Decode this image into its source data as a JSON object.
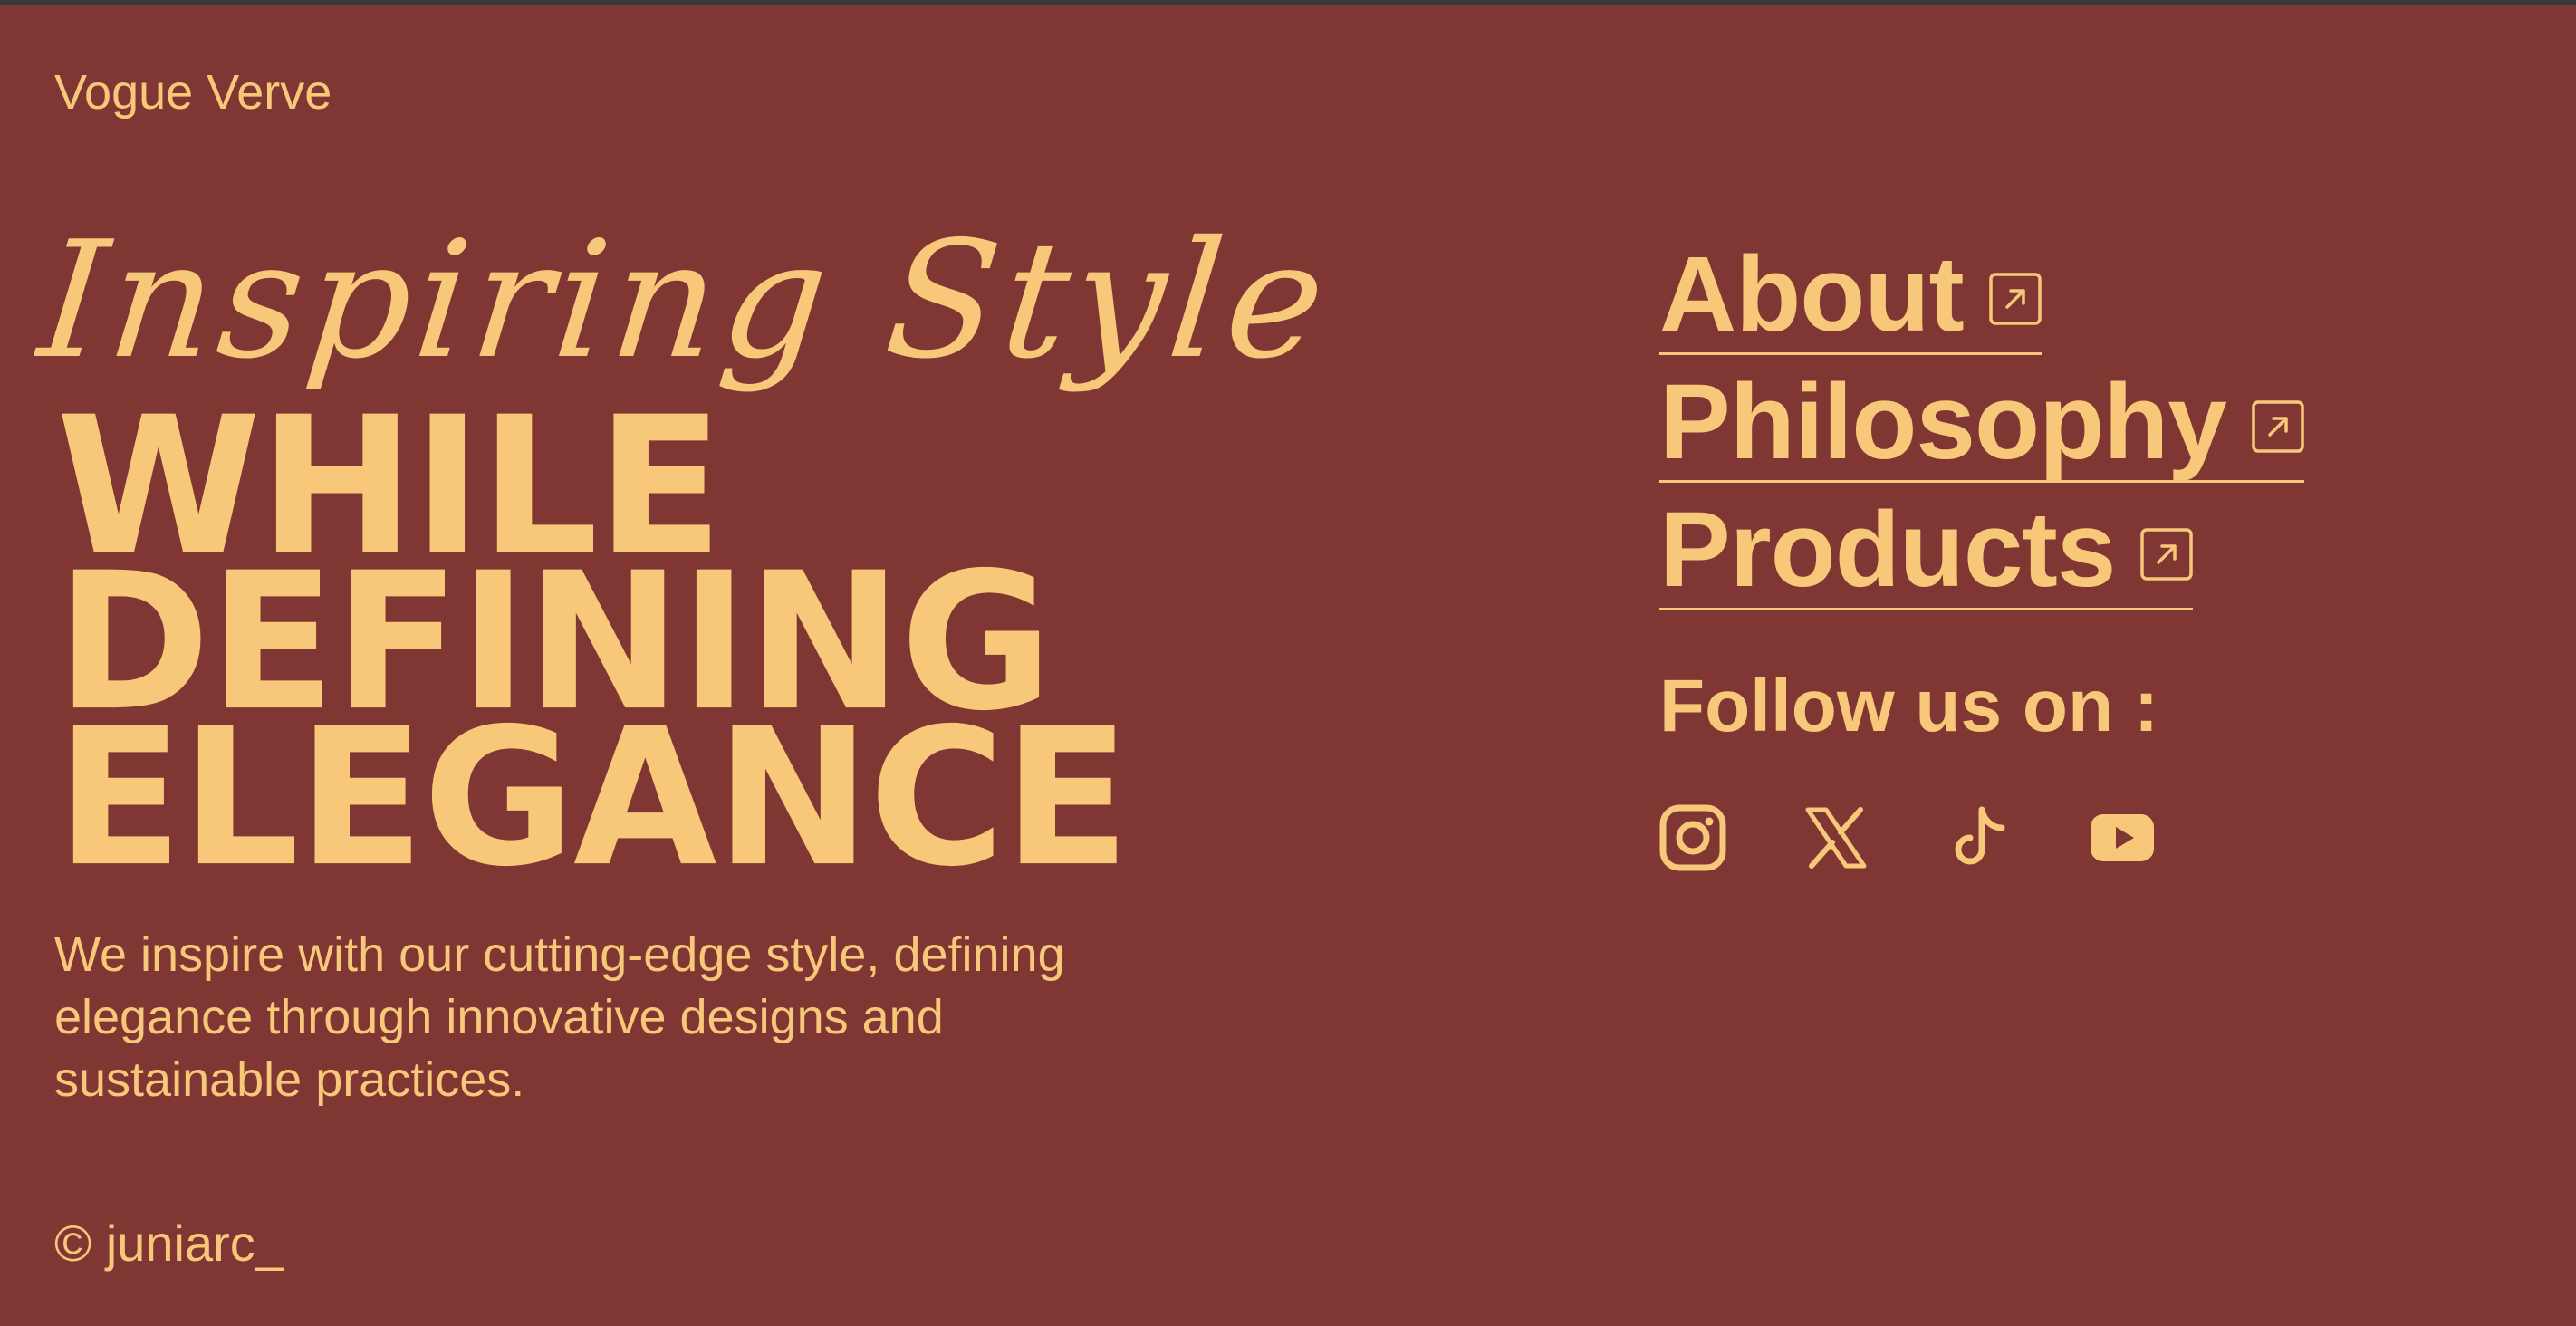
{
  "brand": {
    "name": "Vogue Verve"
  },
  "hero": {
    "script_line": "Inspiring Style",
    "headline": [
      "WHILE",
      "DEFINING",
      "ELEGANCE"
    ],
    "description": "We inspire with our cutting-edge style, defining elegance through innovative designs and sustainable practices."
  },
  "nav": {
    "items": [
      {
        "label": "About",
        "icon": "external-link-icon"
      },
      {
        "label": "Philosophy",
        "icon": "external-link-icon"
      },
      {
        "label": "Products",
        "icon": "external-link-icon"
      }
    ]
  },
  "social": {
    "heading": "Follow us on :",
    "links": [
      {
        "icon": "instagram-icon"
      },
      {
        "icon": "x-icon"
      },
      {
        "icon": "tiktok-icon"
      },
      {
        "icon": "youtube-icon"
      }
    ]
  },
  "footer": {
    "copyright": "© juniarc_"
  },
  "colors": {
    "background": "#803632",
    "accent": "#f7c77a",
    "topbar": "#3a3a3c"
  }
}
